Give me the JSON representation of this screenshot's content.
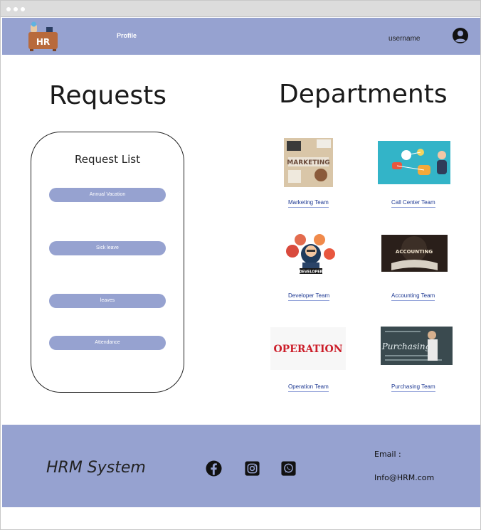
{
  "header": {
    "logo_text": "HR",
    "profile_label": "Profile",
    "username": "username"
  },
  "requests": {
    "heading": "Requests",
    "panel_title": "Request List",
    "items": [
      {
        "label": "Annual Vacation"
      },
      {
        "label": "Sick leave"
      },
      {
        "label": "leaves"
      },
      {
        "label": "Attendance"
      }
    ]
  },
  "departments": {
    "heading": "Departments",
    "items": [
      {
        "label": "Marketing Team",
        "image_text": "MARKETING"
      },
      {
        "label": "Call Center Team",
        "image_text": ""
      },
      {
        "label": "Developer Team",
        "image_text": "DEVELOPER"
      },
      {
        "label": "Accounting Team",
        "image_text": "ACCOUNTING"
      },
      {
        "label": "Operation Team",
        "image_text": "OPERATION"
      },
      {
        "label": "Purchasing Team",
        "image_text": "Purchasing"
      }
    ]
  },
  "footer": {
    "brand": "HRM System",
    "email_label": "Email :",
    "email_value": "Info@HRM.com",
    "social_icons": [
      "facebook-icon",
      "instagram-icon",
      "whatsapp-icon"
    ]
  },
  "colors": {
    "accent": "#96a2d0",
    "link": "#1f3a93"
  }
}
